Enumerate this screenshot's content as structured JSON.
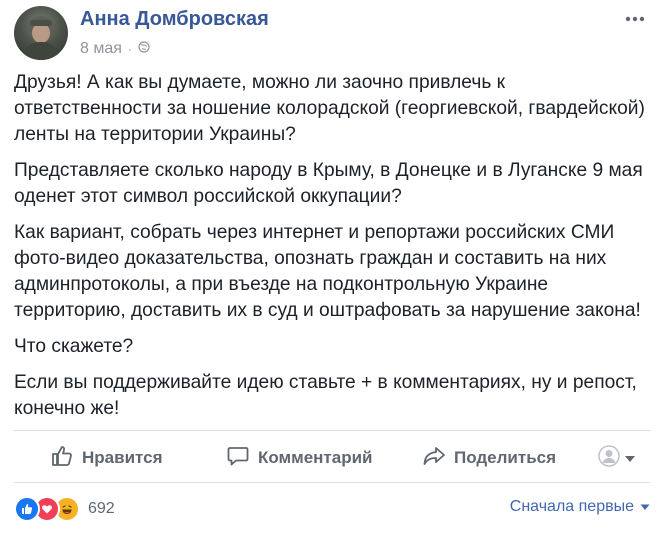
{
  "post": {
    "author": "Анна Домбровская",
    "date": "8 мая",
    "dot": "·",
    "paragraphs": [
      "Друзья! А как вы думаете, можно ли заочно привлечь к ответственности за ношение колорадской (георгиевской, гвардейской) ленты на территории Украины?",
      "Представляете сколько народу в Крыму, в Донецке и в Луганске 9 мая оденет этот символ российской оккупации?",
      "Как вариант, собрать через интернет и репортажи российских СМИ фото-видео доказательства, опознать граждан и составить на них админпротоколы, а при въезде на подконтрольную Украине территорию, доставить их в суд и оштрафовать за нарушение закона!",
      "Что скажете?",
      "Если вы поддерживайте идею ставьте + в комментариях, ну и репост, конечно же!"
    ]
  },
  "actions": {
    "like": "Нравится",
    "comment": "Комментарий",
    "share": "Поделиться"
  },
  "footer": {
    "reaction_count": "692",
    "sort_label": "Сначала первые"
  },
  "colors": {
    "author": "#385898",
    "like_blue": "#1877f2",
    "love_red": "#f33e58",
    "haha_yellow": "#f7b125"
  },
  "icons": [
    "globe-icon",
    "more-options-icon",
    "like-icon",
    "comment-icon",
    "share-icon",
    "avatar-reaction-icon",
    "chevron-down-icon",
    "like-reaction-icon",
    "love-reaction-icon",
    "haha-reaction-icon"
  ]
}
